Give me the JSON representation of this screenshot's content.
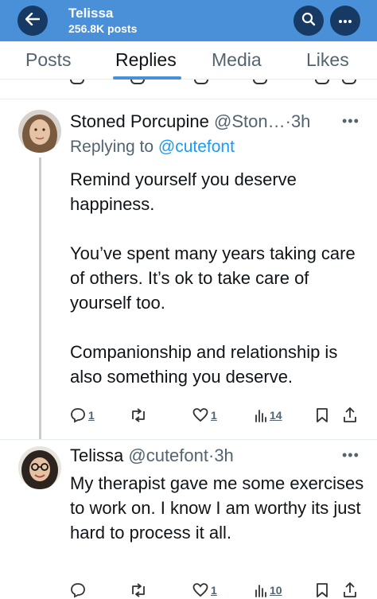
{
  "header": {
    "title": "Telissa",
    "subtitle": "256.8K posts"
  },
  "tabs": [
    {
      "label": "Posts",
      "active": false
    },
    {
      "label": "Replies",
      "active": true
    },
    {
      "label": "Media",
      "active": false
    },
    {
      "label": "Likes",
      "active": false
    }
  ],
  "tweets": [
    {
      "name": "Stoned Porcupine",
      "handle": "@Ston…",
      "time": "·3h",
      "replying_prefix": "Replying to ",
      "replying_to": "@cutefont",
      "text": "Remind yourself you deserve happiness.\n\nYou’ve spent many years taking care of others.  It’s ok to take care of yourself too.\n\nCompanionship and relationship is also something you deserve.",
      "replies": "1",
      "likes": "1",
      "views": "14"
    },
    {
      "name": "Telissa",
      "handle": "@cutefont",
      "time": "·3h",
      "text": "My therapist gave me some exercises to work on. I know I am worthy its just hard to process it all.",
      "likes": "1",
      "views": "10"
    }
  ],
  "colors": {
    "header_bg": "#4a90d9",
    "header_button": "#163a63",
    "accent": "#1d9bf0",
    "muted": "#536471"
  },
  "icons": [
    "back-arrow-icon",
    "search-icon",
    "more-icon",
    "reply-icon",
    "retweet-icon",
    "like-icon",
    "views-icon",
    "bookmark-icon",
    "share-icon"
  ]
}
